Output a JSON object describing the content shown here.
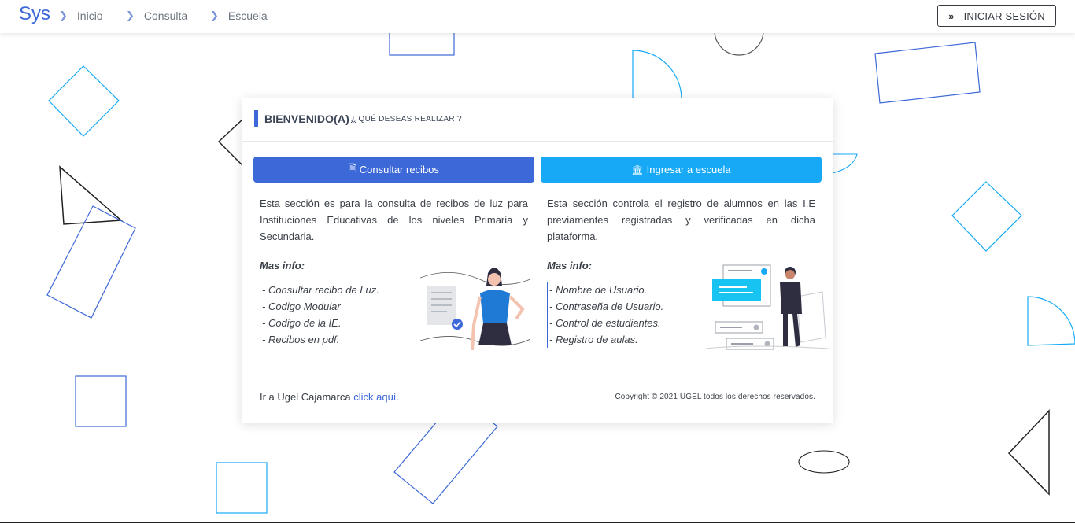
{
  "nav": {
    "brand": "Sys",
    "breadcrumbs": [
      "Inicio",
      "Consulta",
      "Escuela"
    ],
    "login_label": "INICIAR SESIÓN"
  },
  "card": {
    "title": "BIENVENIDO(A)",
    "subtitle_q": "¿",
    "subtitle_rest": " QUÉ DESEAS REALIZAR ?",
    "left": {
      "button_label": "Consultar recibos",
      "button_icon": "document-icon",
      "description": "Esta sección es para la consulta de recibos de luz para Instituciones Educativas de los niveles Primaria y Secundaria.",
      "more_title": "Mas info:",
      "items": [
        "- Consultar recibo de Luz.",
        "- Codigo Modular",
        "- Codigo de la IE.",
        "- Recibos en pdf."
      ]
    },
    "right": {
      "button_label": "Ingresar a escuela",
      "button_icon": "institution-icon",
      "description": "Esta sección controla el registro de alumnos en las I.E previamentes registradas y verificadas en dicha plataforma.",
      "more_title": "Mas info:",
      "items": [
        "- Nombre de Usuario.",
        "- Contraseña de Usuario.",
        "- Control de estudiantes.",
        "- Registro de aulas."
      ]
    },
    "footer_prefix": "Ir a Ugel Cajamarca ",
    "footer_link": "click aquí.",
    "copyright": "Copyright © 2021 UGEL todos los derechos reservados."
  },
  "colors": {
    "primary": "#3d68d8",
    "info": "#17a9f5",
    "text": "#3a3f47"
  }
}
